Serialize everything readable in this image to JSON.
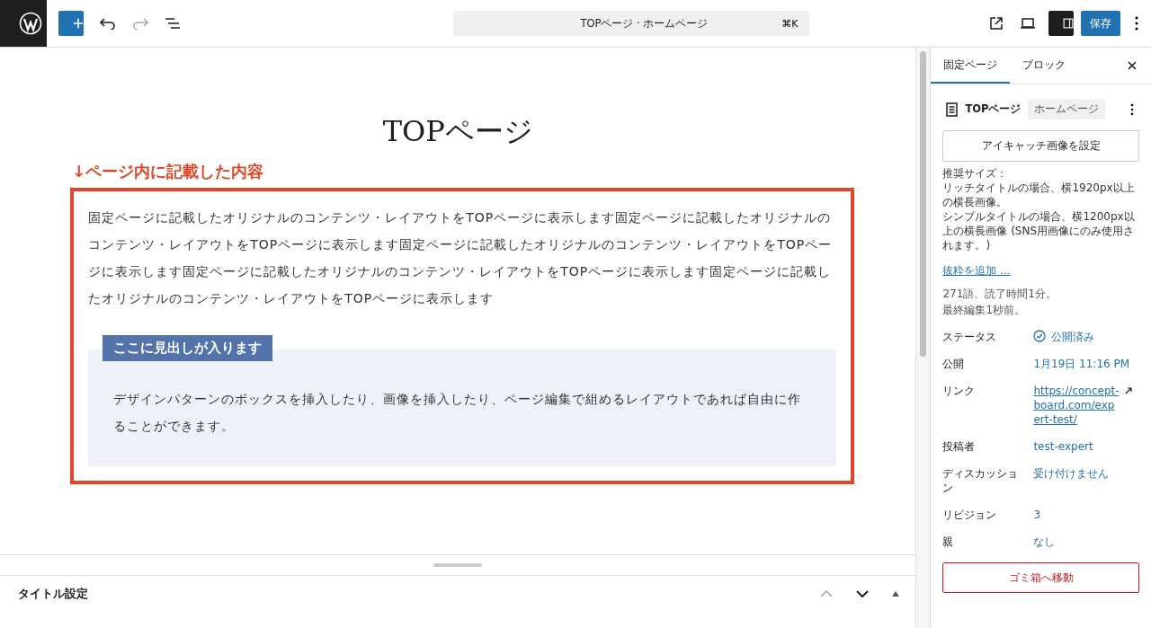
{
  "toolbar": {
    "command_title": "TOPページ · ホームページ",
    "shortcut": "⌘K",
    "save_label": "保存",
    "sidebar_toggle_on": true
  },
  "editor": {
    "page_title": "TOPページ",
    "annotation": "↓ページ内に記載した内容",
    "paragraph": "固定ページに記載したオリジナルのコンテンツ・レイアウトをTOPページに表示します固定ページに記載したオリジナルのコンテンツ・レイアウトをTOPページに表示します固定ページに記載したオリジナルのコンテンツ・レイアウトをTOPページに表示します固定ページに記載したオリジナルのコンテンツ・レイアウトをTOPページに表示します固定ページに記載したオリジナルのコンテンツ・レイアウトをTOPページに表示します",
    "box_heading": "ここに見出しが入ります",
    "box_text": "デザインパターンのボックスを挿入したり、画像を挿入したり、ページ編集で組めるレイアウトであれば自由に作ることができます。"
  },
  "meta_panel": {
    "title": "タイトル設定"
  },
  "sidebar": {
    "tabs": [
      {
        "label": "固定ページ",
        "selected": true
      },
      {
        "label": "ブロック",
        "selected": false
      }
    ],
    "page_name": "TOPページ",
    "page_badge": "ホームページ",
    "featured_button": "アイキャッチ画像を設定",
    "size_note": [
      "推奨サイズ：",
      "リッチタイトルの場合、横1920px以上の横長画像。",
      "シンプルタイトルの場合、横1200px以上の横長画像 (SNS用画像にのみ使用されます。)"
    ],
    "excerpt_link": "抜粋を追加 ...",
    "stats": [
      "271語、読了時間1分。",
      "最終編集1秒前。"
    ],
    "rows": [
      {
        "kind": "status",
        "label": "ステータス",
        "value": "公開済み"
      },
      {
        "kind": "text",
        "label": "公開",
        "value": "1月19日 11:16 PM"
      },
      {
        "kind": "link",
        "label": "リンク",
        "value": "https://concept-board.com/expert-test/"
      },
      {
        "kind": "text",
        "label": "投稿者",
        "value": "test-expert"
      },
      {
        "kind": "text",
        "label": "ディスカッション",
        "value": "受け付けません"
      },
      {
        "kind": "text",
        "label": "リビジョン",
        "value": "3"
      },
      {
        "kind": "text",
        "label": "親",
        "value": "なし"
      }
    ],
    "trash_button": "ゴミ箱へ移動"
  }
}
